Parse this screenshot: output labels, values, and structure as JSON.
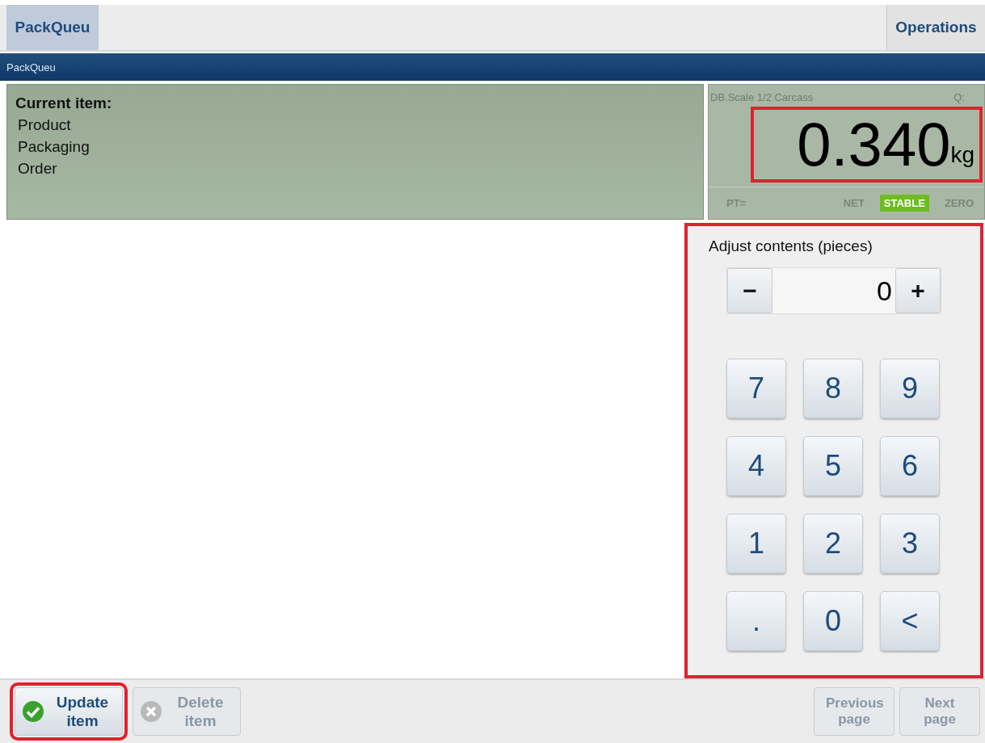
{
  "tabs": [
    {
      "label": "PackQueu",
      "selected": true
    },
    {
      "label": "Operations",
      "selected": false
    }
  ],
  "breadcrumb": "PackQueu",
  "current_item": {
    "title": "Current item:",
    "fields": [
      "Product",
      "Packaging",
      "Order"
    ]
  },
  "scale": {
    "name": "DB.Scale 1/2 Carcass",
    "q_label": "Q:",
    "weight": "0.340",
    "unit": "kg",
    "pt_label": "PT=",
    "indicators": [
      {
        "label": "NET",
        "on": false
      },
      {
        "label": "STABLE",
        "on": true
      },
      {
        "label": "ZERO",
        "on": false
      }
    ]
  },
  "adjust": {
    "title": "Adjust contents (pieces)",
    "minus": "−",
    "value": "0",
    "plus": "+"
  },
  "keypad": [
    "7",
    "8",
    "9",
    "4",
    "5",
    "6",
    "1",
    "2",
    "3",
    ".",
    "0",
    "<"
  ],
  "actions": [
    {
      "label": "Update item",
      "kind": "ok",
      "disabled": false
    },
    {
      "label": "Delete item",
      "kind": "delete",
      "disabled": true
    }
  ],
  "paging": [
    {
      "label": "Previous page",
      "disabled": true
    },
    {
      "label": "Next page",
      "disabled": true
    }
  ]
}
